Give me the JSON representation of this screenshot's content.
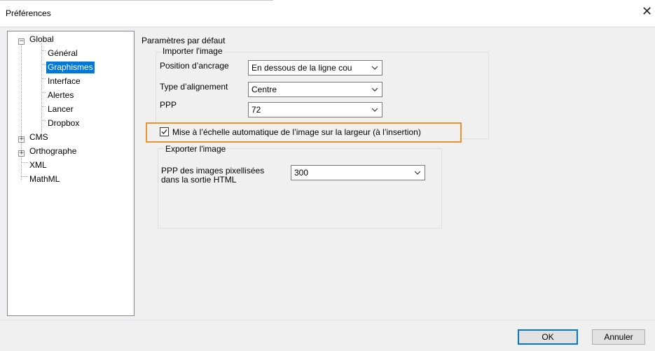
{
  "window": {
    "title": "Préférences",
    "close_glyph": "✕"
  },
  "tree": {
    "items": [
      {
        "label": "Global",
        "expander": "−"
      },
      {
        "label": "Général"
      },
      {
        "label": "Graphismes"
      },
      {
        "label": "Interface"
      },
      {
        "label": "Alertes"
      },
      {
        "label": "Lancer"
      },
      {
        "label": "Dropbox"
      },
      {
        "label": "CMS",
        "expander": "+"
      },
      {
        "label": "Orthographe",
        "expander": "+"
      },
      {
        "label": "XML"
      },
      {
        "label": "MathML"
      }
    ],
    "selected": "Graphismes"
  },
  "panel": {
    "title": "Paramètres par défaut",
    "import_group": {
      "title": "Importer l'image",
      "anchor_label": "Position d’ancrage",
      "anchor_value": "En dessous de la ligne cou",
      "align_label": "Type d’alignement",
      "align_value": "Centre",
      "ppp_label": "PPP",
      "ppp_value": "72"
    },
    "auto_scale": {
      "label": "Mise à l’échelle automatique de l’image sur la largeur (à l’insertion)",
      "checked": true
    },
    "export_group": {
      "title": "Exporter l'image",
      "raster_label_line1": "PPP des images pixellisées",
      "raster_label_line2": "dans la sortie HTML",
      "raster_value": "300"
    }
  },
  "buttons": {
    "ok": "OK",
    "cancel": "Annuler"
  },
  "colors": {
    "selection": "#0078d7",
    "highlight_border": "#f0922b"
  }
}
